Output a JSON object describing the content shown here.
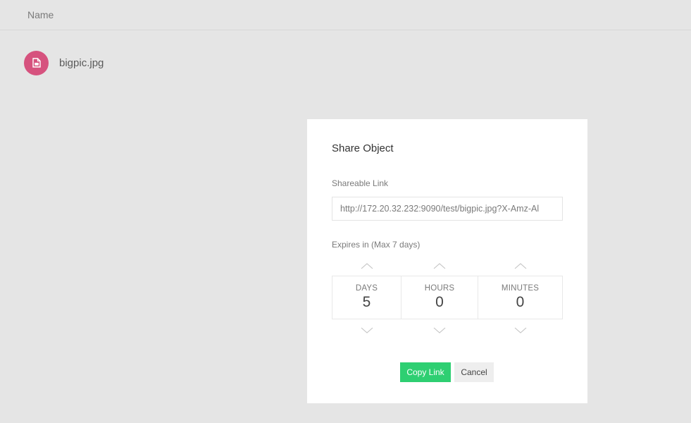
{
  "list": {
    "column_header": "Name",
    "files": [
      {
        "name": "bigpic.jpg",
        "icon": "image-file-icon",
        "icon_color": "#d6527e"
      }
    ]
  },
  "modal": {
    "title": "Share Object",
    "link_label": "Shareable Link",
    "link_value": "http://172.20.32.232:9090/test/bigpic.jpg?X-Amz-Al",
    "expires_label": "Expires in (Max 7 days)",
    "units": {
      "days": {
        "label": "DAYS",
        "value": "5"
      },
      "hours": {
        "label": "HOURS",
        "value": "0"
      },
      "minutes": {
        "label": "MINUTES",
        "value": "0"
      }
    },
    "copy_label": "Copy Link",
    "cancel_label": "Cancel",
    "accent_color": "#2ecf72"
  }
}
